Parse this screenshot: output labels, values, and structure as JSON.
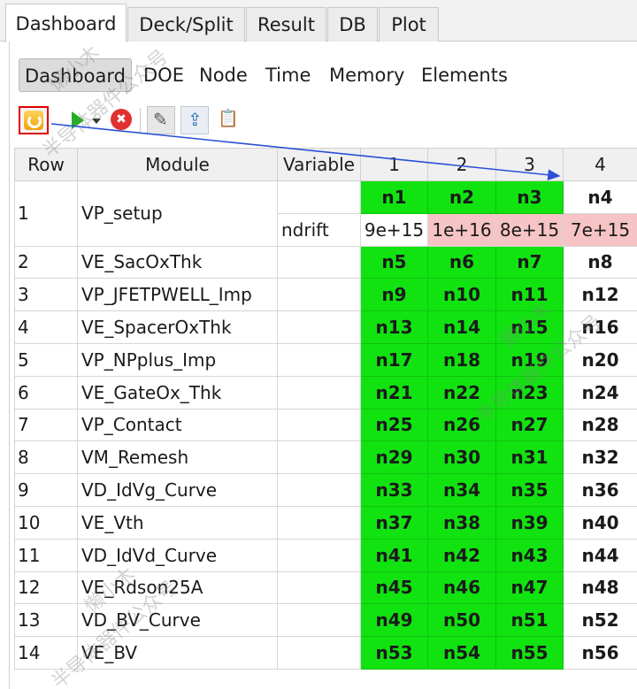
{
  "tabs": [
    "Dashboard",
    "Deck/Split",
    "Result",
    "DB",
    "Plot"
  ],
  "subtabs": [
    "Dashboard",
    "DOE",
    "Node",
    "Time",
    "Memory",
    "Elements"
  ],
  "toolbar": {
    "icons": [
      "refresh-icon",
      "play-icon",
      "dropdown-icon",
      "stop-icon",
      "edit-icon",
      "export-icon",
      "clipboard-icon"
    ]
  },
  "colors": {
    "node_green": "#11e311",
    "value_pink": "#f6c4c4",
    "highlight_red": "#e00000",
    "arrow_blue": "#2b4fd6"
  },
  "table": {
    "headers": [
      "Row",
      "Module",
      "Variable",
      "1",
      "2",
      "3",
      "4"
    ],
    "setup": {
      "row": "1",
      "module": "VP_setup",
      "nodes": [
        "n1",
        "n2",
        "n3",
        "n4"
      ],
      "variable": "ndrift",
      "values": [
        "9e+15",
        "1e+16",
        "8e+15",
        "7e+15"
      ]
    },
    "rows": [
      {
        "row": "2",
        "module": "VE_SacOxThk",
        "nodes": [
          "n5",
          "n6",
          "n7",
          "n8"
        ]
      },
      {
        "row": "3",
        "module": "VP_JFETPWELL_Imp",
        "nodes": [
          "n9",
          "n10",
          "n11",
          "n12"
        ]
      },
      {
        "row": "4",
        "module": "VE_SpacerOxThk",
        "nodes": [
          "n13",
          "n14",
          "n15",
          "n16"
        ]
      },
      {
        "row": "5",
        "module": "VP_NPplus_Imp",
        "nodes": [
          "n17",
          "n18",
          "n19",
          "n20"
        ]
      },
      {
        "row": "6",
        "module": "VE_GateOx_Thk",
        "nodes": [
          "n21",
          "n22",
          "n23",
          "n24"
        ]
      },
      {
        "row": "7",
        "module": "VP_Contact",
        "nodes": [
          "n25",
          "n26",
          "n27",
          "n28"
        ]
      },
      {
        "row": "8",
        "module": "VM_Remesh",
        "nodes": [
          "n29",
          "n30",
          "n31",
          "n32"
        ]
      },
      {
        "row": "9",
        "module": "VD_IdVg_Curve",
        "nodes": [
          "n33",
          "n34",
          "n35",
          "n36"
        ]
      },
      {
        "row": "10",
        "module": "VE_Vth",
        "nodes": [
          "n37",
          "n38",
          "n39",
          "n40"
        ]
      },
      {
        "row": "11",
        "module": "VD_IdVd_Curve",
        "nodes": [
          "n41",
          "n42",
          "n43",
          "n44"
        ]
      },
      {
        "row": "12",
        "module": "VE_Rdson25A",
        "nodes": [
          "n45",
          "n46",
          "n47",
          "n48"
        ]
      },
      {
        "row": "13",
        "module": "VD_BV_Curve",
        "nodes": [
          "n49",
          "n50",
          "n51",
          "n52"
        ]
      },
      {
        "row": "14",
        "module": "VE_BV",
        "nodes": [
          "n53",
          "n54",
          "n55",
          "n56"
        ]
      }
    ]
  },
  "watermark": [
    "懒小木",
    "半导体器件公众号"
  ]
}
